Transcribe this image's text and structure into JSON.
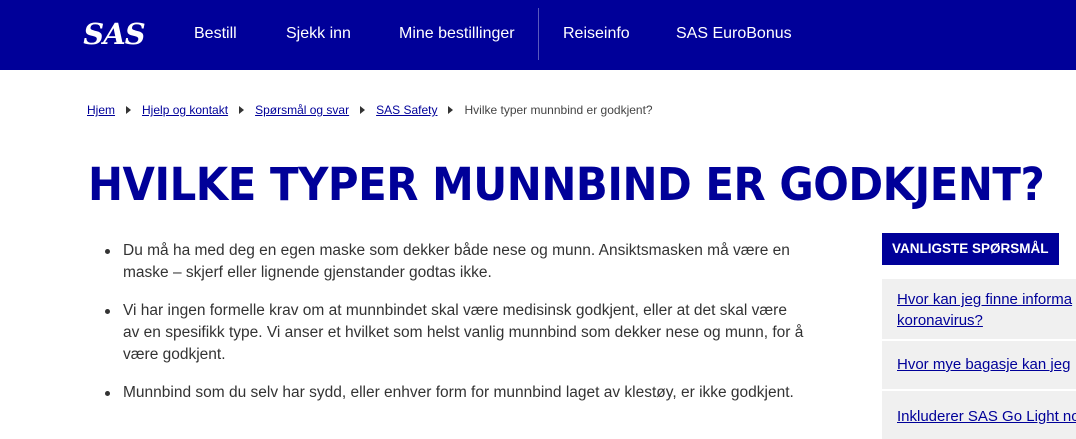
{
  "header": {
    "logo_text": "SAS",
    "brand_color": "#000099",
    "nav": [
      {
        "label": "Bestill"
      },
      {
        "label": "Sjekk inn"
      },
      {
        "label": "Mine bestillinger"
      },
      {
        "label": "Reiseinfo"
      },
      {
        "label": "SAS EuroBonus"
      }
    ]
  },
  "breadcrumb": {
    "items": [
      {
        "label": "Hjem"
      },
      {
        "label": "Hjelp og kontakt"
      },
      {
        "label": "Spørsmål og svar"
      },
      {
        "label": "SAS Safety"
      }
    ],
    "current": "Hvilke typer munnbind er godkjent?"
  },
  "page": {
    "title": "HVILKE TYPER MUNNBIND ER GODKJENT?",
    "bullets": [
      "Du må ha med deg en egen maske som dekker både nese og munn. Ansiktsmasken må være en maske – skjerf eller lignende gjenstander godtas ikke.",
      "Vi har ingen formelle krav om at munnbindet skal være medisinsk godkjent, eller at det skal være av en spesifikk type. Vi anser et hvilket som helst vanlig munnbind som dekker nese og munn, for å være godkjent.",
      "Munnbind som du selv har sydd, eller enhver form for munnbind laget av klestøy, er ikke godkjent."
    ]
  },
  "faq": {
    "header": "VANLIGSTE SPØRSMÅL",
    "items": [
      {
        "line1": "Hvor kan jeg finne informa",
        "line2": "koronavirus?"
      },
      {
        "line1": "Hvor mye bagasje kan jeg"
      },
      {
        "line1": "Inkluderer SAS Go Light no"
      }
    ]
  }
}
